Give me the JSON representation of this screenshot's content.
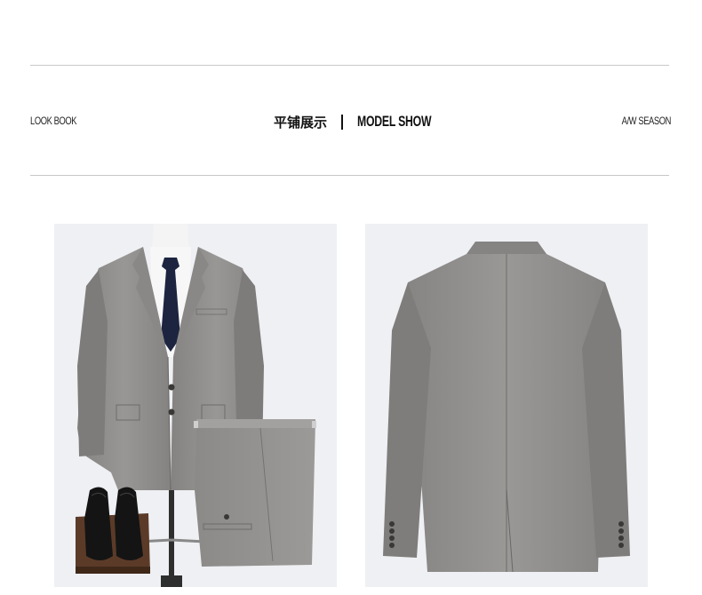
{
  "header": {
    "left_label": "LOOK BOOK",
    "title_cn": "平铺展示",
    "title_en": "MODEL SHOW",
    "right_label": "A/W SEASON"
  },
  "colors": {
    "suit_gray": "#8f8d8b",
    "tie_navy": "#1c2440",
    "panel_bg": "#eef0f3",
    "rule_gray": "#c8c8c8"
  },
  "images": {
    "front": {
      "icon": "suit-front-with-trousers-and-shoes-icon"
    },
    "back": {
      "icon": "suit-back-view-icon"
    }
  }
}
